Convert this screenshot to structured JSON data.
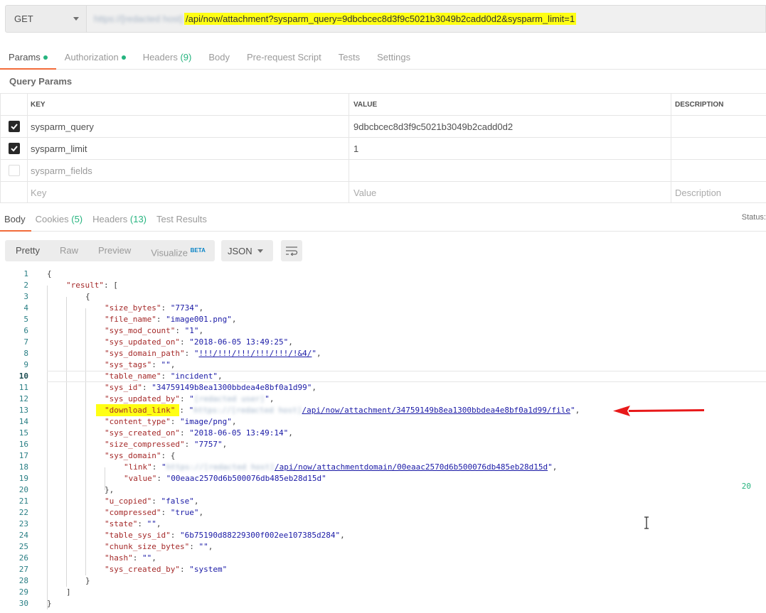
{
  "request": {
    "method": "GET",
    "url_host": "https://[redacted host]",
    "url_path": "/api/now/attachment?sysparm_query=9dbcbcec8d3f9c5021b3049b2cadd0d2&sysparm_limit=1"
  },
  "request_tabs": [
    {
      "label": "Params",
      "dot": true
    },
    {
      "label": "Authorization",
      "dot": true
    },
    {
      "label": "Headers",
      "count": "(9)"
    },
    {
      "label": "Body"
    },
    {
      "label": "Pre-request Script"
    },
    {
      "label": "Tests"
    },
    {
      "label": "Settings"
    }
  ],
  "query_params": {
    "title": "Query Params",
    "headers": {
      "key": "KEY",
      "value": "VALUE",
      "description": "DESCRIPTION"
    },
    "rows": [
      {
        "checked": true,
        "key": "sysparm_query",
        "value": "9dbcbcec8d3f9c5021b3049b2cadd0d2",
        "description": ""
      },
      {
        "checked": true,
        "key": "sysparm_limit",
        "value": "1",
        "description": ""
      },
      {
        "checked": false,
        "key": "sysparm_fields",
        "value": "",
        "description": ""
      }
    ],
    "placeholders": {
      "key": "Key",
      "value": "Value",
      "description": "Description"
    }
  },
  "response_tabs": [
    {
      "label": "Body"
    },
    {
      "label": "Cookies",
      "count": "(5)"
    },
    {
      "label": "Headers",
      "count": "(13)"
    },
    {
      "label": "Test Results"
    }
  ],
  "status": {
    "label": "Status:",
    "code": "20"
  },
  "view_modes": [
    {
      "label": "Pretty"
    },
    {
      "label": "Raw"
    },
    {
      "label": "Preview"
    },
    {
      "label": "Visualize",
      "badge": "BETA"
    }
  ],
  "format": "JSON",
  "json_lines": [
    {
      "n": "1",
      "indent": 0,
      "tokens": [
        [
          "p",
          "{"
        ]
      ]
    },
    {
      "n": "2",
      "indent": 1,
      "tokens": [
        [
          "k",
          "\"result\""
        ],
        [
          "p",
          ": ["
        ]
      ]
    },
    {
      "n": "3",
      "indent": 2,
      "tokens": [
        [
          "p",
          "{"
        ]
      ]
    },
    {
      "n": "4",
      "indent": 3,
      "tokens": [
        [
          "k",
          "\"size_bytes\""
        ],
        [
          "p",
          ": "
        ],
        [
          "s",
          "\"7734\""
        ],
        [
          "p",
          ","
        ]
      ]
    },
    {
      "n": "5",
      "indent": 3,
      "tokens": [
        [
          "k",
          "\"file_name\""
        ],
        [
          "p",
          ": "
        ],
        [
          "s",
          "\"image001.png\""
        ],
        [
          "p",
          ","
        ]
      ]
    },
    {
      "n": "6",
      "indent": 3,
      "tokens": [
        [
          "k",
          "\"sys_mod_count\""
        ],
        [
          "p",
          ": "
        ],
        [
          "s",
          "\"1\""
        ],
        [
          "p",
          ","
        ]
      ]
    },
    {
      "n": "7",
      "indent": 3,
      "tokens": [
        [
          "k",
          "\"sys_updated_on\""
        ],
        [
          "p",
          ": "
        ],
        [
          "s",
          "\"2018-06-05 13:49:25\""
        ],
        [
          "p",
          ","
        ]
      ]
    },
    {
      "n": "8",
      "indent": 3,
      "tokens": [
        [
          "k",
          "\"sys_domain_path\""
        ],
        [
          "p",
          ": "
        ],
        [
          "s",
          "\""
        ],
        [
          "l",
          "!!!/!!!/!!!/!!!/!!!/!&4/"
        ],
        [
          "s",
          "\""
        ],
        [
          "p",
          ","
        ]
      ]
    },
    {
      "n": "9",
      "indent": 3,
      "tokens": [
        [
          "k",
          "\"sys_tags\""
        ],
        [
          "p",
          ": "
        ],
        [
          "s",
          "\"\""
        ],
        [
          "p",
          ","
        ]
      ]
    },
    {
      "n": "10",
      "indent": 3,
      "cursor": true,
      "tokens": [
        [
          "k",
          "\"table_name\""
        ],
        [
          "p",
          ": "
        ],
        [
          "s",
          "\"incident\""
        ],
        [
          "p",
          ","
        ]
      ]
    },
    {
      "n": "11",
      "indent": 3,
      "tokens": [
        [
          "k",
          "\"sys_id\""
        ],
        [
          "p",
          ": "
        ],
        [
          "s",
          "\"34759149b8ea1300bbdea4e8bf0a1d99\""
        ],
        [
          "p",
          ","
        ]
      ]
    },
    {
      "n": "12",
      "indent": 3,
      "tokens": [
        [
          "k",
          "\"sys_updated_by\""
        ],
        [
          "p",
          ": "
        ],
        [
          "s",
          "\""
        ],
        [
          "b",
          "[redacted user]"
        ],
        [
          "s",
          "\""
        ],
        [
          "p",
          ","
        ]
      ]
    },
    {
      "n": "13",
      "indent": 3,
      "tokens": [
        [
          "h",
          "\"download_link\""
        ],
        [
          "p",
          ": "
        ],
        [
          "s",
          "\""
        ],
        [
          "b",
          "https://[redacted host]"
        ],
        [
          "l",
          "/api/now/attachment/34759149b8ea1300bbdea4e8bf0a1d99/file"
        ],
        [
          "s",
          "\""
        ],
        [
          "p",
          ","
        ]
      ]
    },
    {
      "n": "14",
      "indent": 3,
      "tokens": [
        [
          "k",
          "\"content_type\""
        ],
        [
          "p",
          ": "
        ],
        [
          "s",
          "\"image/png\""
        ],
        [
          "p",
          ","
        ]
      ]
    },
    {
      "n": "15",
      "indent": 3,
      "tokens": [
        [
          "k",
          "\"sys_created_on\""
        ],
        [
          "p",
          ": "
        ],
        [
          "s",
          "\"2018-06-05 13:49:14\""
        ],
        [
          "p",
          ","
        ]
      ]
    },
    {
      "n": "16",
      "indent": 3,
      "tokens": [
        [
          "k",
          "\"size_compressed\""
        ],
        [
          "p",
          ": "
        ],
        [
          "s",
          "\"7757\""
        ],
        [
          "p",
          ","
        ]
      ]
    },
    {
      "n": "17",
      "indent": 3,
      "tokens": [
        [
          "k",
          "\"sys_domain\""
        ],
        [
          "p",
          ": {"
        ]
      ]
    },
    {
      "n": "18",
      "indent": 4,
      "tokens": [
        [
          "k",
          "\"link\""
        ],
        [
          "p",
          ": "
        ],
        [
          "s",
          "\""
        ],
        [
          "b",
          "https://[redacted host]"
        ],
        [
          "l",
          "/api/now/attachmentdomain/00eaac2570d6b500076db485eb28d15d"
        ],
        [
          "s",
          "\""
        ],
        [
          "p",
          ","
        ]
      ]
    },
    {
      "n": "19",
      "indent": 4,
      "tokens": [
        [
          "k",
          "\"value\""
        ],
        [
          "p",
          ": "
        ],
        [
          "s",
          "\"00eaac2570d6b500076db485eb28d15d\""
        ]
      ]
    },
    {
      "n": "20",
      "indent": 3,
      "tokens": [
        [
          "p",
          "},"
        ]
      ]
    },
    {
      "n": "21",
      "indent": 3,
      "tokens": [
        [
          "k",
          "\"u_copied\""
        ],
        [
          "p",
          ": "
        ],
        [
          "s",
          "\"false\""
        ],
        [
          "p",
          ","
        ]
      ]
    },
    {
      "n": "22",
      "indent": 3,
      "tokens": [
        [
          "k",
          "\"compressed\""
        ],
        [
          "p",
          ": "
        ],
        [
          "s",
          "\"true\""
        ],
        [
          "p",
          ","
        ]
      ]
    },
    {
      "n": "23",
      "indent": 3,
      "tokens": [
        [
          "k",
          "\"state\""
        ],
        [
          "p",
          ": "
        ],
        [
          "s",
          "\"\""
        ],
        [
          "p",
          ","
        ]
      ]
    },
    {
      "n": "24",
      "indent": 3,
      "tokens": [
        [
          "k",
          "\"table_sys_id\""
        ],
        [
          "p",
          ": "
        ],
        [
          "s",
          "\"6b75190d88229300f002ee107385d284\""
        ],
        [
          "p",
          ","
        ]
      ]
    },
    {
      "n": "25",
      "indent": 3,
      "tokens": [
        [
          "k",
          "\"chunk_size_bytes\""
        ],
        [
          "p",
          ": "
        ],
        [
          "s",
          "\"\""
        ],
        [
          "p",
          ","
        ]
      ]
    },
    {
      "n": "26",
      "indent": 3,
      "tokens": [
        [
          "k",
          "\"hash\""
        ],
        [
          "p",
          ": "
        ],
        [
          "s",
          "\"\""
        ],
        [
          "p",
          ","
        ]
      ]
    },
    {
      "n": "27",
      "indent": 3,
      "tokens": [
        [
          "k",
          "\"sys_created_by\""
        ],
        [
          "p",
          ": "
        ],
        [
          "s",
          "\"system\""
        ]
      ]
    },
    {
      "n": "28",
      "indent": 2,
      "tokens": [
        [
          "p",
          "}"
        ]
      ]
    },
    {
      "n": "29",
      "indent": 1,
      "tokens": [
        [
          "p",
          "]"
        ]
      ]
    },
    {
      "n": "30",
      "indent": 0,
      "tokens": [
        [
          "p",
          "}"
        ]
      ]
    }
  ],
  "colors": {
    "accent_tab": "#f26b3a",
    "success": "#26b47f",
    "highlight": "#ffff14",
    "annotation_arrow": "#e8191a"
  },
  "icons": {
    "method_dropdown": "chevron-down-icon",
    "format_dropdown": "chevron-down-icon",
    "wrap": "wrap-lines-icon",
    "checkbox": "check-icon",
    "annotation": "arrow-left-icon",
    "cursor": "text-cursor-icon"
  }
}
